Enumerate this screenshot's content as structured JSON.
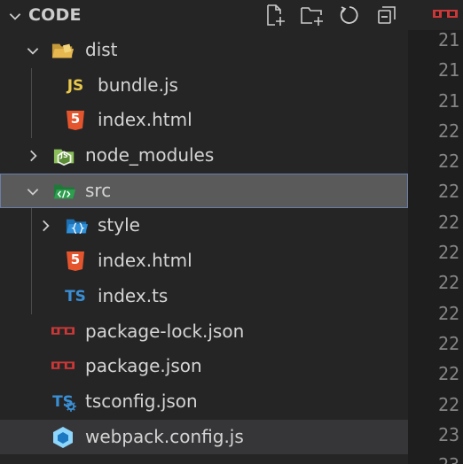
{
  "explorer": {
    "title": "CODE",
    "actions": [
      {
        "name": "new-file",
        "icon": "new-file-icon"
      },
      {
        "name": "new-folder",
        "icon": "new-folder-icon"
      },
      {
        "name": "refresh",
        "icon": "refresh-icon"
      },
      {
        "name": "collapse-all",
        "icon": "collapse-all-icon"
      }
    ],
    "tree": [
      {
        "label": "dist",
        "type": "folder",
        "expanded": true,
        "depth": 1,
        "icon": "folder-dist-icon"
      },
      {
        "label": "bundle.js",
        "type": "file",
        "depth": 2,
        "icon": "javascript-file-icon",
        "icon_text": "JS"
      },
      {
        "label": "index.html",
        "type": "file",
        "depth": 2,
        "icon": "html-file-icon",
        "icon_text": "5"
      },
      {
        "label": "node_modules",
        "type": "folder",
        "expanded": false,
        "depth": 1,
        "icon": "folder-node-icon",
        "icon_text": "JS"
      },
      {
        "label": "src",
        "type": "folder",
        "expanded": true,
        "depth": 1,
        "icon": "folder-src-icon",
        "selected": true
      },
      {
        "label": "style",
        "type": "folder",
        "expanded": false,
        "depth": 2,
        "icon": "folder-style-icon"
      },
      {
        "label": "index.html",
        "type": "file",
        "depth": 2,
        "icon": "html-file-icon",
        "icon_text": "5"
      },
      {
        "label": "index.ts",
        "type": "file",
        "depth": 2,
        "icon": "typescript-file-icon",
        "icon_text": "TS"
      },
      {
        "label": "package-lock.json",
        "type": "file",
        "depth": 1,
        "icon": "npm-file-icon"
      },
      {
        "label": "package.json",
        "type": "file",
        "depth": 1,
        "icon": "npm-file-icon"
      },
      {
        "label": "tsconfig.json",
        "type": "file",
        "depth": 1,
        "icon": "tsconfig-file-icon",
        "icon_text": "TS"
      },
      {
        "label": "webpack.config.js",
        "type": "file",
        "depth": 1,
        "icon": "webpack-file-icon",
        "hover": true
      }
    ]
  },
  "editor": {
    "line_numbers": [
      "21",
      "21",
      "21",
      "22",
      "22",
      "22",
      "22",
      "22",
      "22",
      "22",
      "22",
      "22",
      "22",
      "23",
      "23"
    ]
  },
  "colors": {
    "background": "#252526",
    "editor_background": "#1e1e1e",
    "selected_row": "#5a5a5a",
    "hover_row": "#363638",
    "text": "#d4d4d4",
    "line_number": "#858585",
    "js_yellow": "#e8c84b",
    "html_orange": "#e4552e",
    "ts_blue": "#3a8fd4",
    "npm_red": "#cb3837",
    "src_green": "#2e9e4f",
    "webpack_blue": "#8ed6fb"
  }
}
